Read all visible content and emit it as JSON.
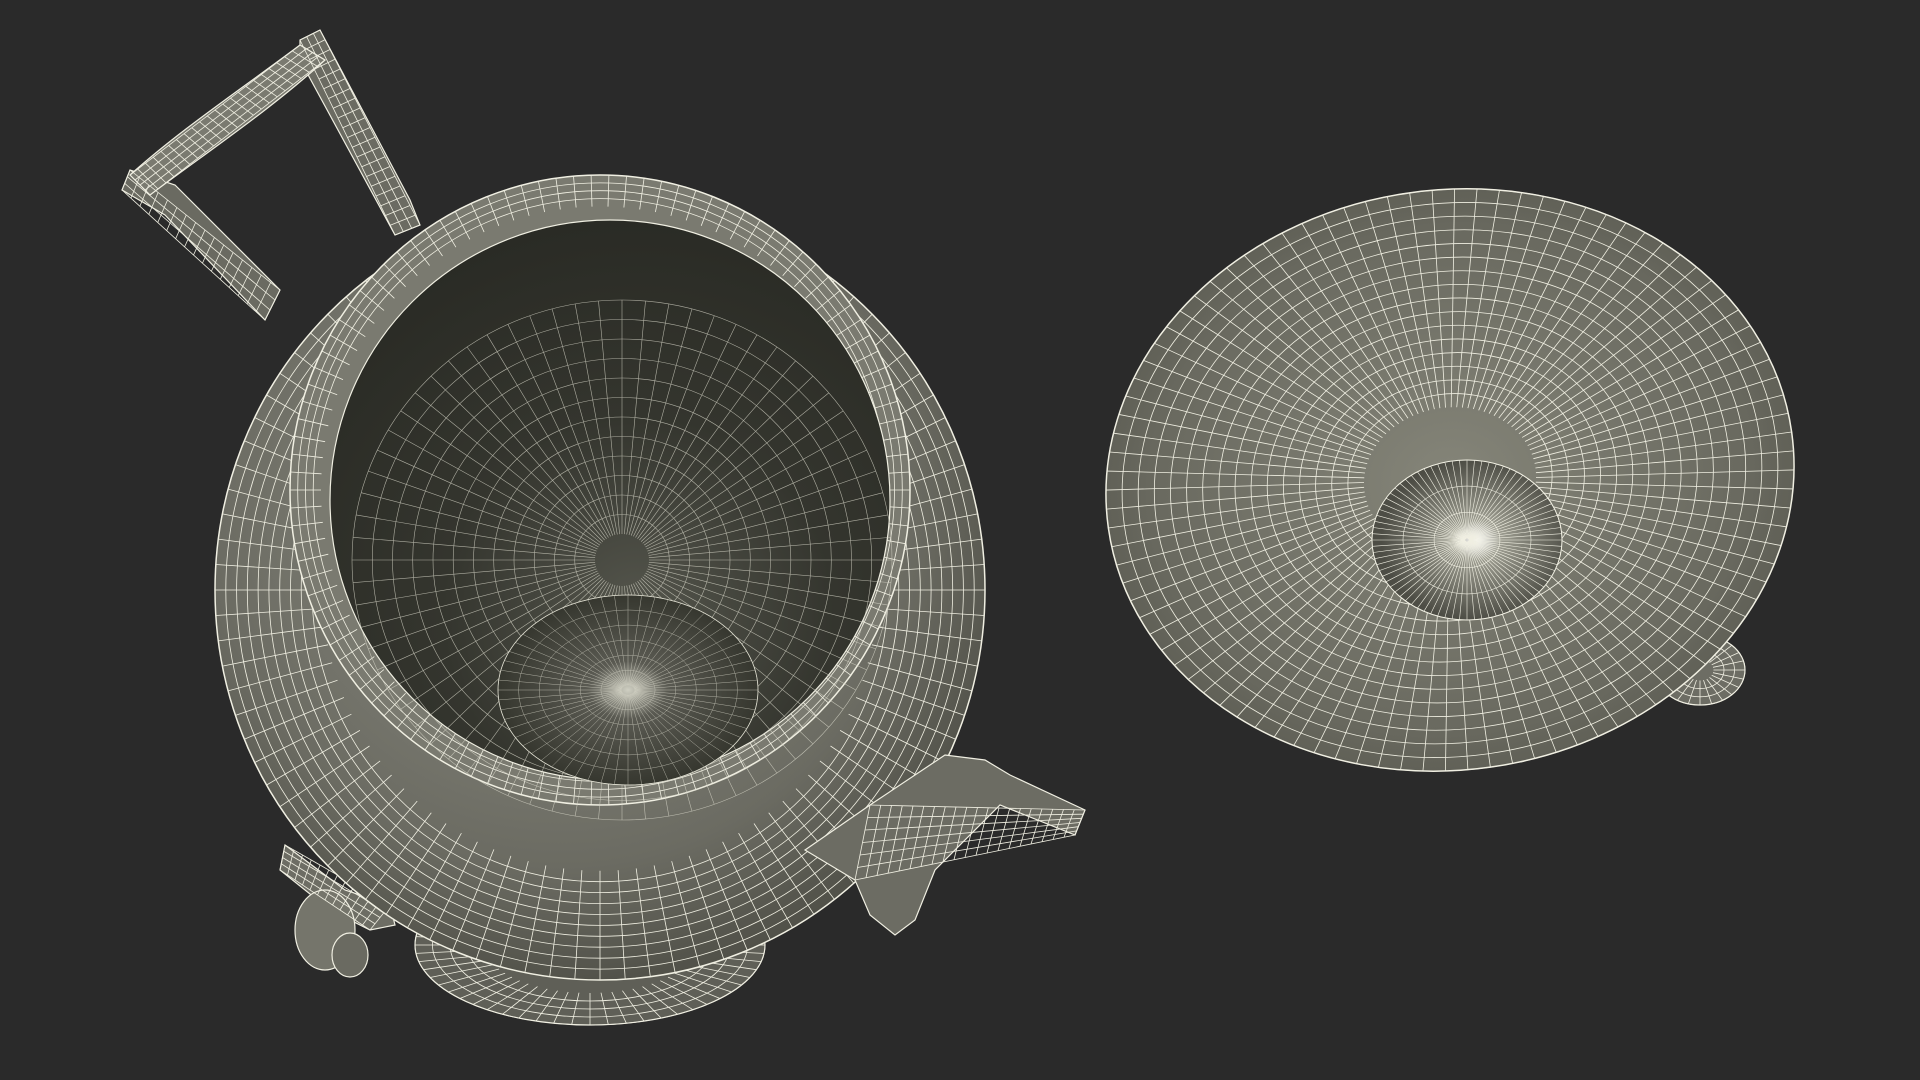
{
  "scene": {
    "background_color": "#2a2a2a",
    "objects": [
      {
        "name": "urn-body",
        "description_icon": "wireframe-urn"
      },
      {
        "name": "urn-lid",
        "description_icon": "wireframe-lid"
      }
    ]
  },
  "colors": {
    "shell_light": "#8e8e84",
    "shell_mid": "#6d6d64",
    "shell_dark": "#48483f",
    "interior_dark": "#2e2f28",
    "wire": "#f0efe2"
  }
}
